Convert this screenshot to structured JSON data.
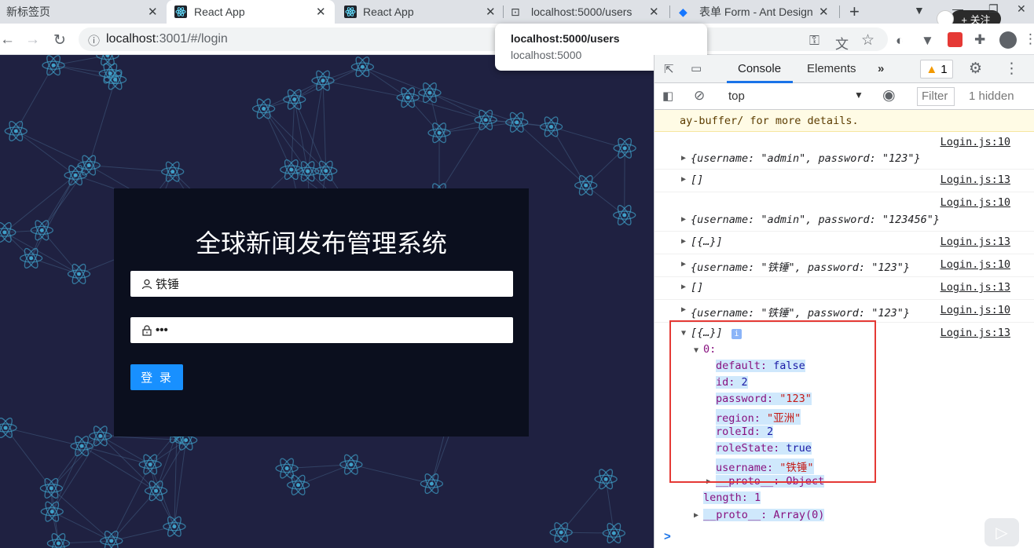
{
  "tabs": [
    {
      "title": "新标签页"
    },
    {
      "title": "React App"
    },
    {
      "title": "React App"
    },
    {
      "title": "localhost:5000/users"
    },
    {
      "title": "表单 Form - Ant Design"
    }
  ],
  "follow_label": "+ 关注",
  "url": {
    "host": "localhost",
    "rest": ":3001/#/login"
  },
  "tooltip": {
    "title": "localhost:5000/users",
    "subtitle": "localhost:5000"
  },
  "login": {
    "title": "全球新闻发布管理系统",
    "username_value": "铁锤",
    "password_mask": "•••",
    "submit_label": "登 录"
  },
  "devtools": {
    "tabs": {
      "console": "Console",
      "elements": "Elements",
      "more": "»"
    },
    "warning_count": "1",
    "context": "top",
    "filter_placeholder": "Filter",
    "hidden_label": "1 hidden",
    "warning_tail": "ay-buffer/ for more details.",
    "logs": [
      {
        "text": "{username: \"admin\", password: \"123\"}",
        "src": "Login.js:10"
      },
      {
        "text": "[]",
        "src": "Login.js:13"
      },
      {
        "text": "{username: \"admin\", password: \"123456\"}",
        "src": "Login.js:10"
      },
      {
        "text": "[{…}]",
        "src": "Login.js:13"
      },
      {
        "text": "{username: \"铁锤\", password: \"123\"}",
        "src": "Login.js:10"
      },
      {
        "text": "[]",
        "src": "Login.js:13"
      },
      {
        "text": "{username: \"铁锤\", password: \"123\"}",
        "src": "Login.js:10"
      },
      {
        "text": "[{…}]",
        "src": "Login.js:13"
      }
    ],
    "expanded": {
      "index_label": "0:",
      "props": [
        {
          "key": "default",
          "value": "false"
        },
        {
          "key": "id",
          "value": "2"
        },
        {
          "key": "password",
          "value": "\"123\""
        },
        {
          "key": "region",
          "value": "\"亚洲\""
        },
        {
          "key": "roleId",
          "value": "2"
        },
        {
          "key": "roleState",
          "value": "true"
        },
        {
          "key": "username",
          "value": "\"铁锤\""
        }
      ],
      "proto_obj": "__proto__: Object",
      "length": "length: 1",
      "proto_arr": "__proto__: Array(0)"
    },
    "prompt": ">"
  },
  "colors": {
    "accent": "#1890ff",
    "page_bg": "#1f2141",
    "login_bg": "#0b0f1e",
    "highlight_box": "#e53935"
  }
}
